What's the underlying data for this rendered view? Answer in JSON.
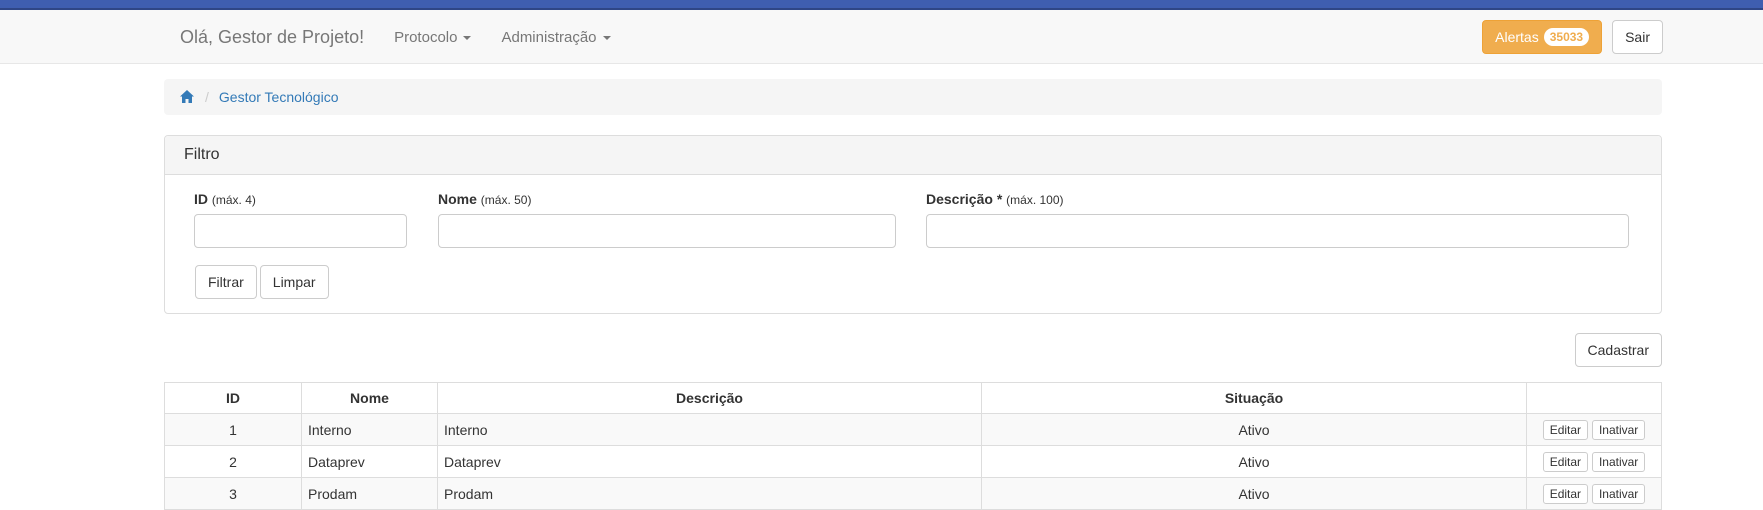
{
  "navbar": {
    "greeting": "Olá, Gestor de Projeto!",
    "menus": [
      {
        "label": "Protocolo"
      },
      {
        "label": "Administração"
      }
    ],
    "alerts_label": "Alertas",
    "alerts_count": "35033",
    "logout_label": "Sair"
  },
  "breadcrumb": {
    "current": "Gestor Tecnológico"
  },
  "filter": {
    "title": "Filtro",
    "id_label": "ID",
    "id_hint": "(máx. 4)",
    "id_value": "",
    "name_label": "Nome",
    "name_hint": "(máx. 50)",
    "name_value": "",
    "desc_label": "Descrição *",
    "desc_hint": "(máx. 100)",
    "desc_value": "",
    "filter_button": "Filtrar",
    "clear_button": "Limpar"
  },
  "actions": {
    "create_button": "Cadastrar"
  },
  "table": {
    "headers": [
      "ID",
      "Nome",
      "Descrição",
      "Situação",
      ""
    ],
    "rows": [
      {
        "id": "1",
        "name": "Interno",
        "desc": "Interno",
        "status": "Ativo",
        "edit": "Editar",
        "deactivate": "Inativar"
      },
      {
        "id": "2",
        "name": "Dataprev",
        "desc": "Dataprev",
        "status": "Ativo",
        "edit": "Editar",
        "deactivate": "Inativar"
      },
      {
        "id": "3",
        "name": "Prodam",
        "desc": "Prodam",
        "status": "Ativo",
        "edit": "Editar",
        "deactivate": "Inativar"
      }
    ]
  },
  "colors": {
    "top_strip": "#3f5eb0",
    "warning": "#f0ad4e",
    "link": "#337ab7"
  }
}
